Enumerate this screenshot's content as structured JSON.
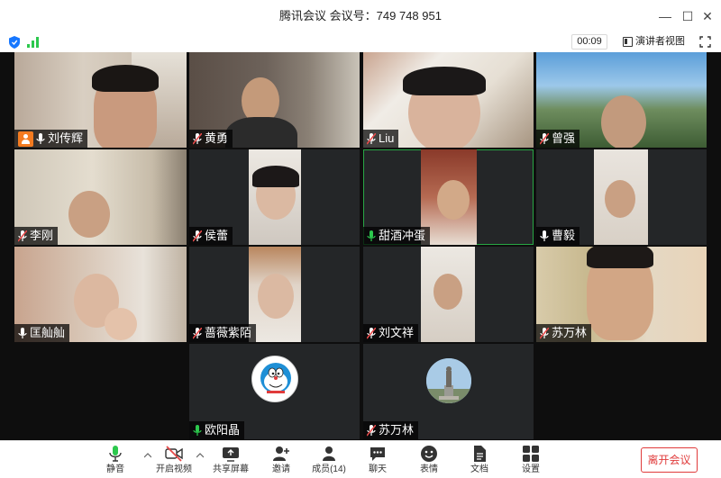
{
  "window": {
    "title": "腾讯会议 会议号：749 748 951",
    "minimize": "—",
    "maximize": "☐",
    "close": "✕"
  },
  "infobar": {
    "timer": "00:09",
    "view_label": "演讲者视图"
  },
  "participants": [
    {
      "name": "刘传辉",
      "mic": "on",
      "host": true
    },
    {
      "name": "黄勇",
      "mic": "muted"
    },
    {
      "name": "Liu",
      "mic": "muted"
    },
    {
      "name": "曾强",
      "mic": "muted"
    },
    {
      "name": "李刚",
      "mic": "muted"
    },
    {
      "name": "侯蕾",
      "mic": "muted"
    },
    {
      "name": "甜酒冲蛋",
      "mic": "speaking",
      "active": true
    },
    {
      "name": "曹毅",
      "mic": "on"
    },
    {
      "name": "匡舢舢",
      "mic": "on"
    },
    {
      "name": "蔷薇紫陌",
      "mic": "muted"
    },
    {
      "name": "刘文祥",
      "mic": "muted"
    },
    {
      "name": "苏万林",
      "mic": "muted"
    },
    {
      "name": "欧阳晶",
      "mic": "speaking"
    },
    {
      "name": "苏万林",
      "mic": "muted"
    }
  ],
  "toolbar": {
    "mute": "静音",
    "video": "开启视频",
    "share": "共享屏幕",
    "invite": "邀请",
    "members": "成员(14)",
    "chat": "聊天",
    "reactions": "表情",
    "docs": "文档",
    "settings": "设置",
    "leave": "离开会议"
  },
  "colors": {
    "accent": "#0a7cff",
    "speaking": "#2cc84d",
    "muted": "#e64a4a",
    "host_badge": "#f47b20",
    "leave": "#e03b3b"
  }
}
